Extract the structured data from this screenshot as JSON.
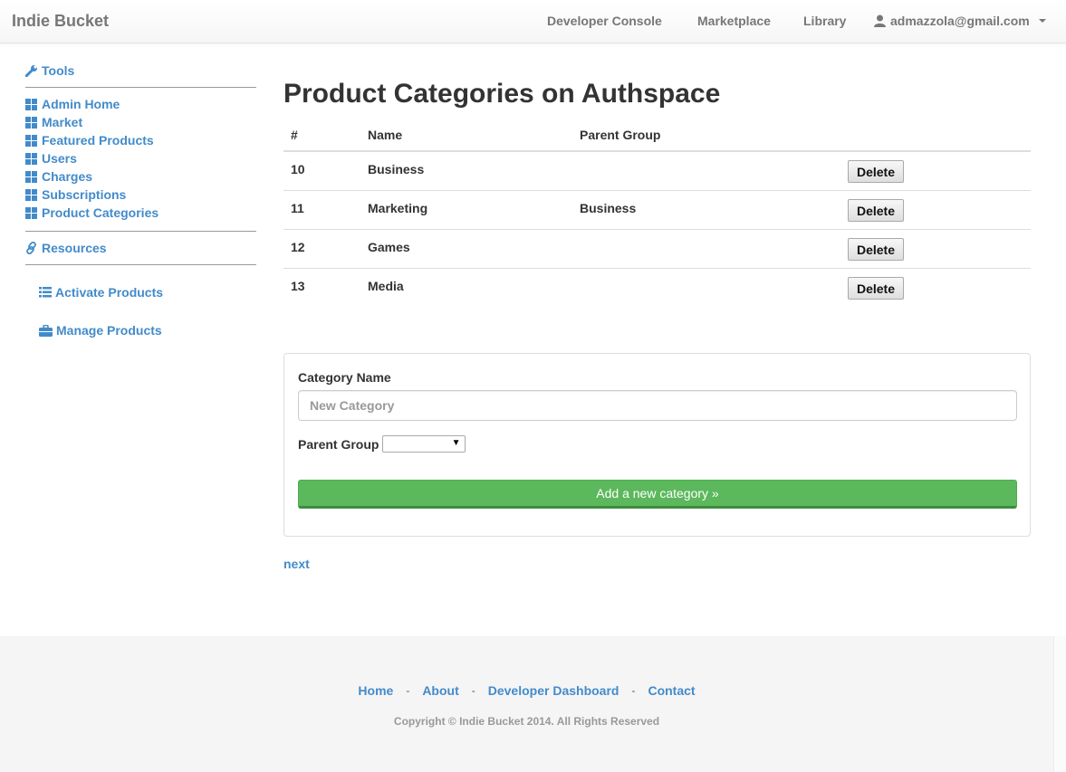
{
  "navbar": {
    "brand": "Indie Bucket",
    "links": [
      "Developer Console",
      "Marketplace",
      "Library"
    ],
    "user_email": "admazzola@gmail.com"
  },
  "sidebar": {
    "tools_heading": "Tools",
    "items": [
      "Admin Home",
      "Market",
      "Featured Products",
      "Users",
      "Charges",
      "Subscriptions",
      "Product Categories"
    ],
    "resources_heading": "Resources",
    "resource_links": [
      "Activate Products",
      "Manage Products"
    ]
  },
  "main": {
    "title": "Product Categories on Authspace",
    "table": {
      "headers": [
        "#",
        "Name",
        "Parent Group"
      ],
      "rows": [
        {
          "id": "10",
          "name": "Business",
          "parent": "",
          "action": "Delete"
        },
        {
          "id": "11",
          "name": "Marketing",
          "parent": "Business",
          "action": "Delete"
        },
        {
          "id": "12",
          "name": "Games",
          "parent": "",
          "action": "Delete"
        },
        {
          "id": "13",
          "name": "Media",
          "parent": "",
          "action": "Delete"
        }
      ]
    },
    "form": {
      "category_label": "Category Name",
      "category_placeholder": "New Category",
      "parent_label": "Parent Group",
      "parent_selected": "",
      "submit_label": "Add a new category »"
    },
    "next_label": "next"
  },
  "footer": {
    "links": [
      "Home",
      "About",
      "Developer Dashboard",
      "Contact"
    ],
    "separator": "-",
    "copyright": "Copyright © Indie Bucket 2014. All Rights Reserved"
  },
  "colors": {
    "link": "#428bca",
    "success": "#5cb85c",
    "nav_text": "#777777"
  }
}
